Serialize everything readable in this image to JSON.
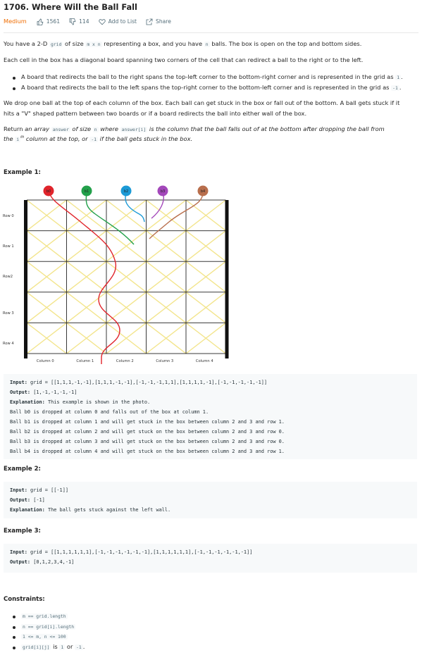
{
  "header": {
    "title": "1706. Where Will the Ball Fall",
    "difficulty": "Medium",
    "likes": "1561",
    "dislikes": "114",
    "add_to_list": "Add to List",
    "share": "Share",
    "difficulty_color": "#ef6c00"
  },
  "description": {
    "p1_a": "You have a 2-D ",
    "p1_grid": "grid",
    "p1_b": " of size ",
    "p1_mxn": "m x n",
    "p1_c": " representing a box, and you have ",
    "p1_n": "n",
    "p1_d": " balls. The box is open on the top and bottom sides.",
    "p2": "Each cell in the box has a diagonal board spanning two corners of the cell that can redirect a ball to the right or to the left.",
    "b1_text": "A board that redirects the ball to the right spans the top-left corner to the bottom-right corner and is represented in the grid as ",
    "b1_code": "1",
    "b1_end": ".",
    "b2_text": "A board that redirects the ball to the left spans the top-right corner to the bottom-left corner and is represented in the grid as ",
    "b2_code": "-1",
    "b2_end": ".",
    "p3_line1": "We drop one ball at the top of each column of the box. Each ball can get stuck in the box or fall out of the bottom. A ball gets stuck if it",
    "p3_line2": "hits a \"V\" shaped pattern between two boards or if a board redirects the ball into either wall of the box.",
    "p4_a": "Return ",
    "p4_b": "an array ",
    "p4_answer": "answer",
    "p4_c": " of size ",
    "p4_n": "n",
    "p4_d": " where ",
    "p4_answeri": "answer[i]",
    "p4_e": " is the column that the ball falls out of at the bottom after dropping the ball from",
    "p4_f": "the ",
    "p4_i": "i",
    "p4_th": "th",
    "p4_g": " column at the top, or ",
    "p4_neg1": "-1",
    "p4_h": " if the ball gets stuck in the box."
  },
  "example1": {
    "heading": "Example 1:",
    "row_labels": [
      "Row 0",
      "Row 1",
      "Row2",
      "Row 3",
      "Row 4"
    ],
    "col_labels": [
      "Column 0",
      "Column 1",
      "Column 2",
      "Column 3",
      "Column 4"
    ],
    "balls": [
      {
        "label": "b0",
        "color": "#e0242b"
      },
      {
        "label": "b1",
        "color": "#22a04a"
      },
      {
        "label": "b2",
        "color": "#1b9ad6"
      },
      {
        "label": "b3",
        "color": "#a347ba"
      },
      {
        "label": "b4",
        "color": "#b86e4c"
      }
    ],
    "grid": [
      [
        1,
        1,
        1,
        -1,
        -1
      ],
      [
        1,
        1,
        1,
        -1,
        -1
      ],
      [
        -1,
        -1,
        -1,
        1,
        1
      ],
      [
        1,
        1,
        1,
        1,
        -1
      ],
      [
        -1,
        -1,
        -1,
        -1,
        -1
      ]
    ],
    "input_label": "Input:",
    "input_value": " grid = [[1,1,1,-1,-1],[1,1,1,-1,-1],[-1,-1,-1,1,1],[1,1,1,1,-1],[-1,-1,-1,-1,-1]]",
    "output_label": "Output:",
    "output_value": " [1,-1,-1,-1,-1]",
    "explanation_label": "Explanation:",
    "explanation_value": " This example is shown in the photo.",
    "lines": [
      "Ball b0 is dropped at column 0 and falls out of the box at column 1.",
      "Ball b1 is dropped at column 1 and will get stuck in the box between column 2 and 3 and row 1.",
      "Ball b2 is dropped at column 2 and will get stuck on the box between column 2 and 3 and row 0.",
      "Ball b3 is dropped at column 3 and will get stuck on the box between column 2 and 3 and row 0.",
      "Ball b4 is dropped at column 4 and will get stuck on the box between column 2 and 3 and row 1."
    ]
  },
  "example2": {
    "heading": "Example 2:",
    "input_label": "Input:",
    "input_value": " grid = [[-1]]",
    "output_label": "Output:",
    "output_value": " [-1]",
    "explanation_label": "Explanation:",
    "explanation_value": " The ball gets stuck against the left wall."
  },
  "example3": {
    "heading": "Example 3:",
    "input_label": "Input:",
    "input_value": " grid = [[1,1,1,1,1,1],[-1,-1,-1,-1,-1,-1],[1,1,1,1,1,1],[-1,-1,-1,-1,-1,-1]]",
    "output_label": "Output:",
    "output_value": " [0,1,2,3,4,-1]"
  },
  "constraints": {
    "heading": "Constraints:",
    "c1": "m == grid.length",
    "c2": "n == grid[i].length",
    "c3": "1 <= m, n <= 100",
    "c4_code": "grid[i][j]",
    "c4_a": " is ",
    "c4_one": "1",
    "c4_b": " or ",
    "c4_neg": "-1",
    "c4_c": "."
  },
  "icons": {
    "like": "thumbs-up-icon",
    "dislike": "thumbs-down-icon",
    "add_to_list": "heart-icon",
    "share": "share-icon"
  }
}
